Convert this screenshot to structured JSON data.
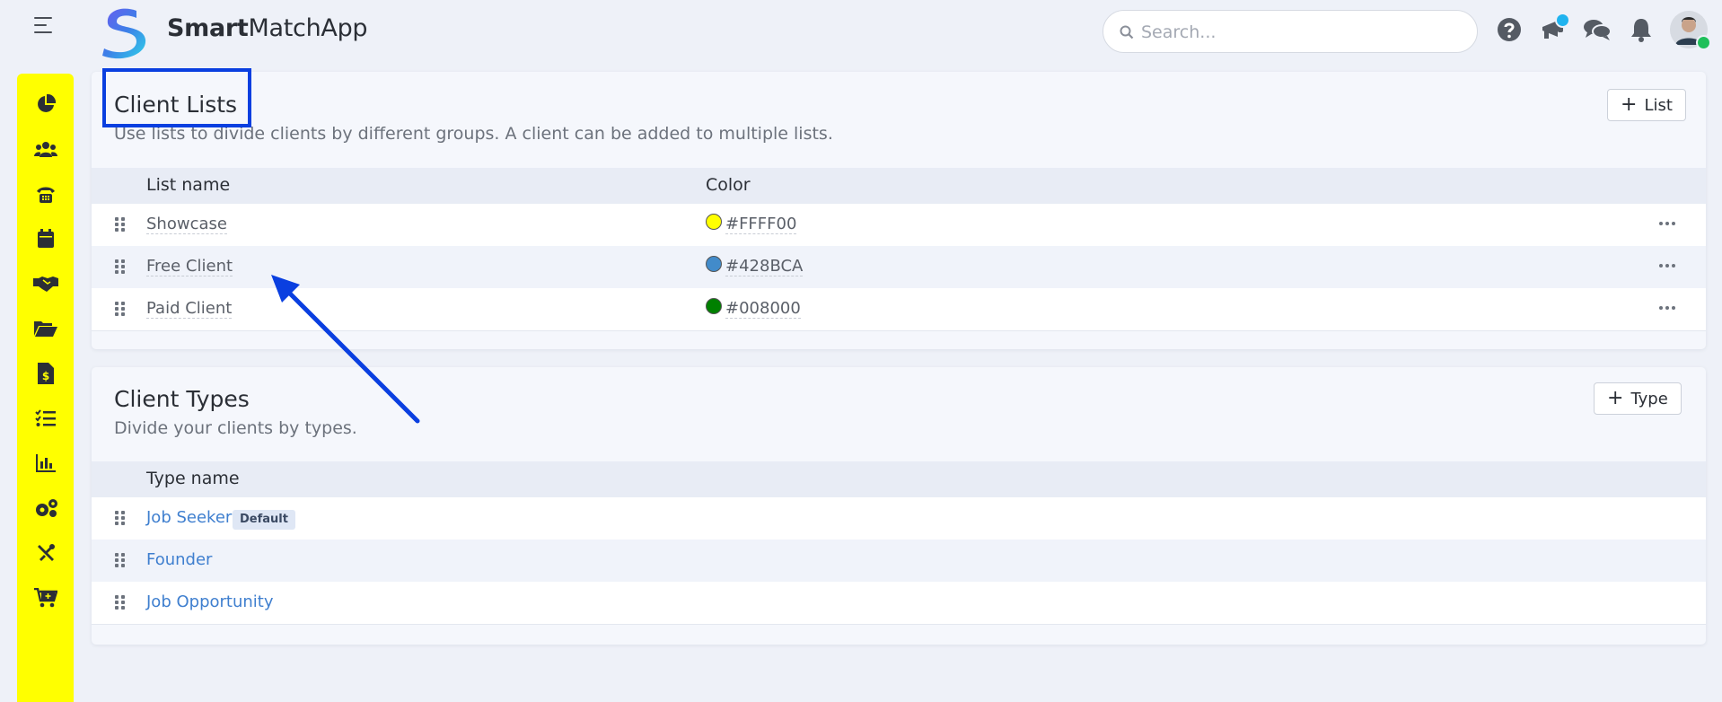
{
  "app": {
    "brand_bold": "Smart",
    "brand_rest": "MatchApp"
  },
  "search": {
    "placeholder": "Search..."
  },
  "top_icons": [
    "help-icon",
    "announcement-icon",
    "chat-icon",
    "bell-icon",
    "user-avatar"
  ],
  "sidebar": {
    "background": "#FFFF00",
    "items": [
      "dashboard-icon",
      "clients-icon",
      "calls-icon",
      "calendar-icon",
      "deals-icon",
      "folders-icon",
      "invoices-icon",
      "tasks-icon",
      "reports-icon",
      "settings-icon",
      "tools-icon",
      "store-icon"
    ]
  },
  "client_lists": {
    "title": "Client Lists",
    "description": "Use lists to divide clients by different groups. A client can be added to multiple lists.",
    "add_button": "List",
    "columns": [
      "List name",
      "Color"
    ],
    "rows": [
      {
        "name": "Showcase",
        "color": "#FFFF00"
      },
      {
        "name": "Free Client",
        "color": "#428BCA"
      },
      {
        "name": "Paid Client",
        "color": "#008000"
      }
    ]
  },
  "client_types": {
    "title": "Client Types",
    "description": "Divide your clients by types.",
    "add_button": "Type",
    "columns": [
      "Type name"
    ],
    "rows": [
      {
        "name": "Job Seeker",
        "tag": "Default"
      },
      {
        "name": "Founder"
      },
      {
        "name": "Job Opportunity"
      }
    ]
  },
  "annotation": {
    "highlight_color": "#0A3FE0"
  }
}
